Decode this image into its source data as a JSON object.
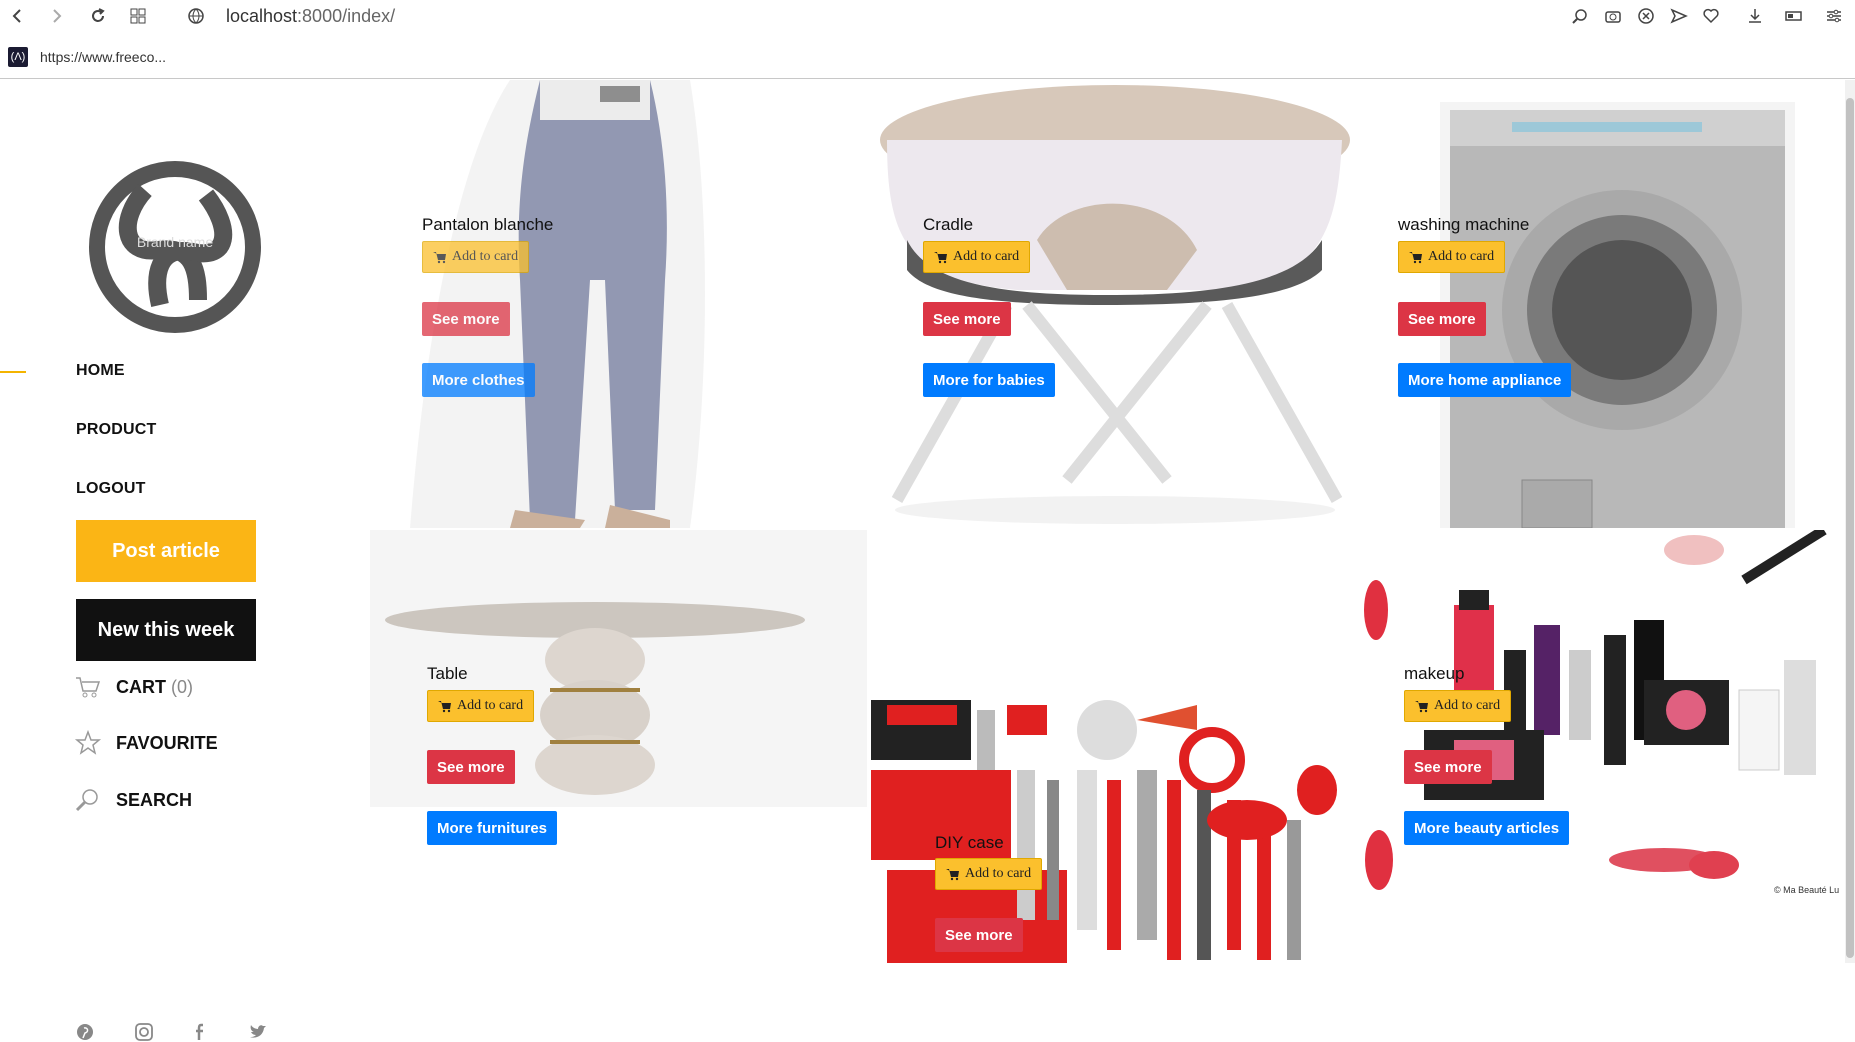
{
  "browser": {
    "url_host": "localhost",
    "url_rest": ":8000/index/",
    "bookmark": "https://www.freeco..."
  },
  "sidebar": {
    "logo_watermark": "Brand name",
    "nav": [
      {
        "label": "HOME"
      },
      {
        "label": "PRODUCT"
      },
      {
        "label": "LOGOUT"
      }
    ],
    "post_article": "Post article",
    "new_this_week": "New this week",
    "cart": {
      "label": "CART",
      "count": "(0)"
    },
    "favourite": "FAVOURITE",
    "search": "SEARCH"
  },
  "products": [
    {
      "name": "Pantalon blanche",
      "add": "Add to card",
      "see": "See more",
      "more": "More clothes"
    },
    {
      "name": "Cradle",
      "add": "Add to card",
      "see": "See more",
      "more": "More for babies"
    },
    {
      "name": "washing machine",
      "add": "Add to card",
      "see": "See more",
      "more": "More home appliance"
    },
    {
      "name": "Table",
      "add": "Add to card",
      "see": "See more",
      "more": "More furnitures"
    },
    {
      "name": "DIY case",
      "add": "Add to card",
      "see": "See more",
      "more": ""
    },
    {
      "name": "makeup",
      "add": "Add to card",
      "see": "See more",
      "more": "More beauty articles"
    }
  ],
  "image_credit": "© Ma Beauté Lu",
  "colors": {
    "yellow": "#fbc02d",
    "red": "#dc3545",
    "blue": "#007bff",
    "accent": "#fbb515"
  }
}
